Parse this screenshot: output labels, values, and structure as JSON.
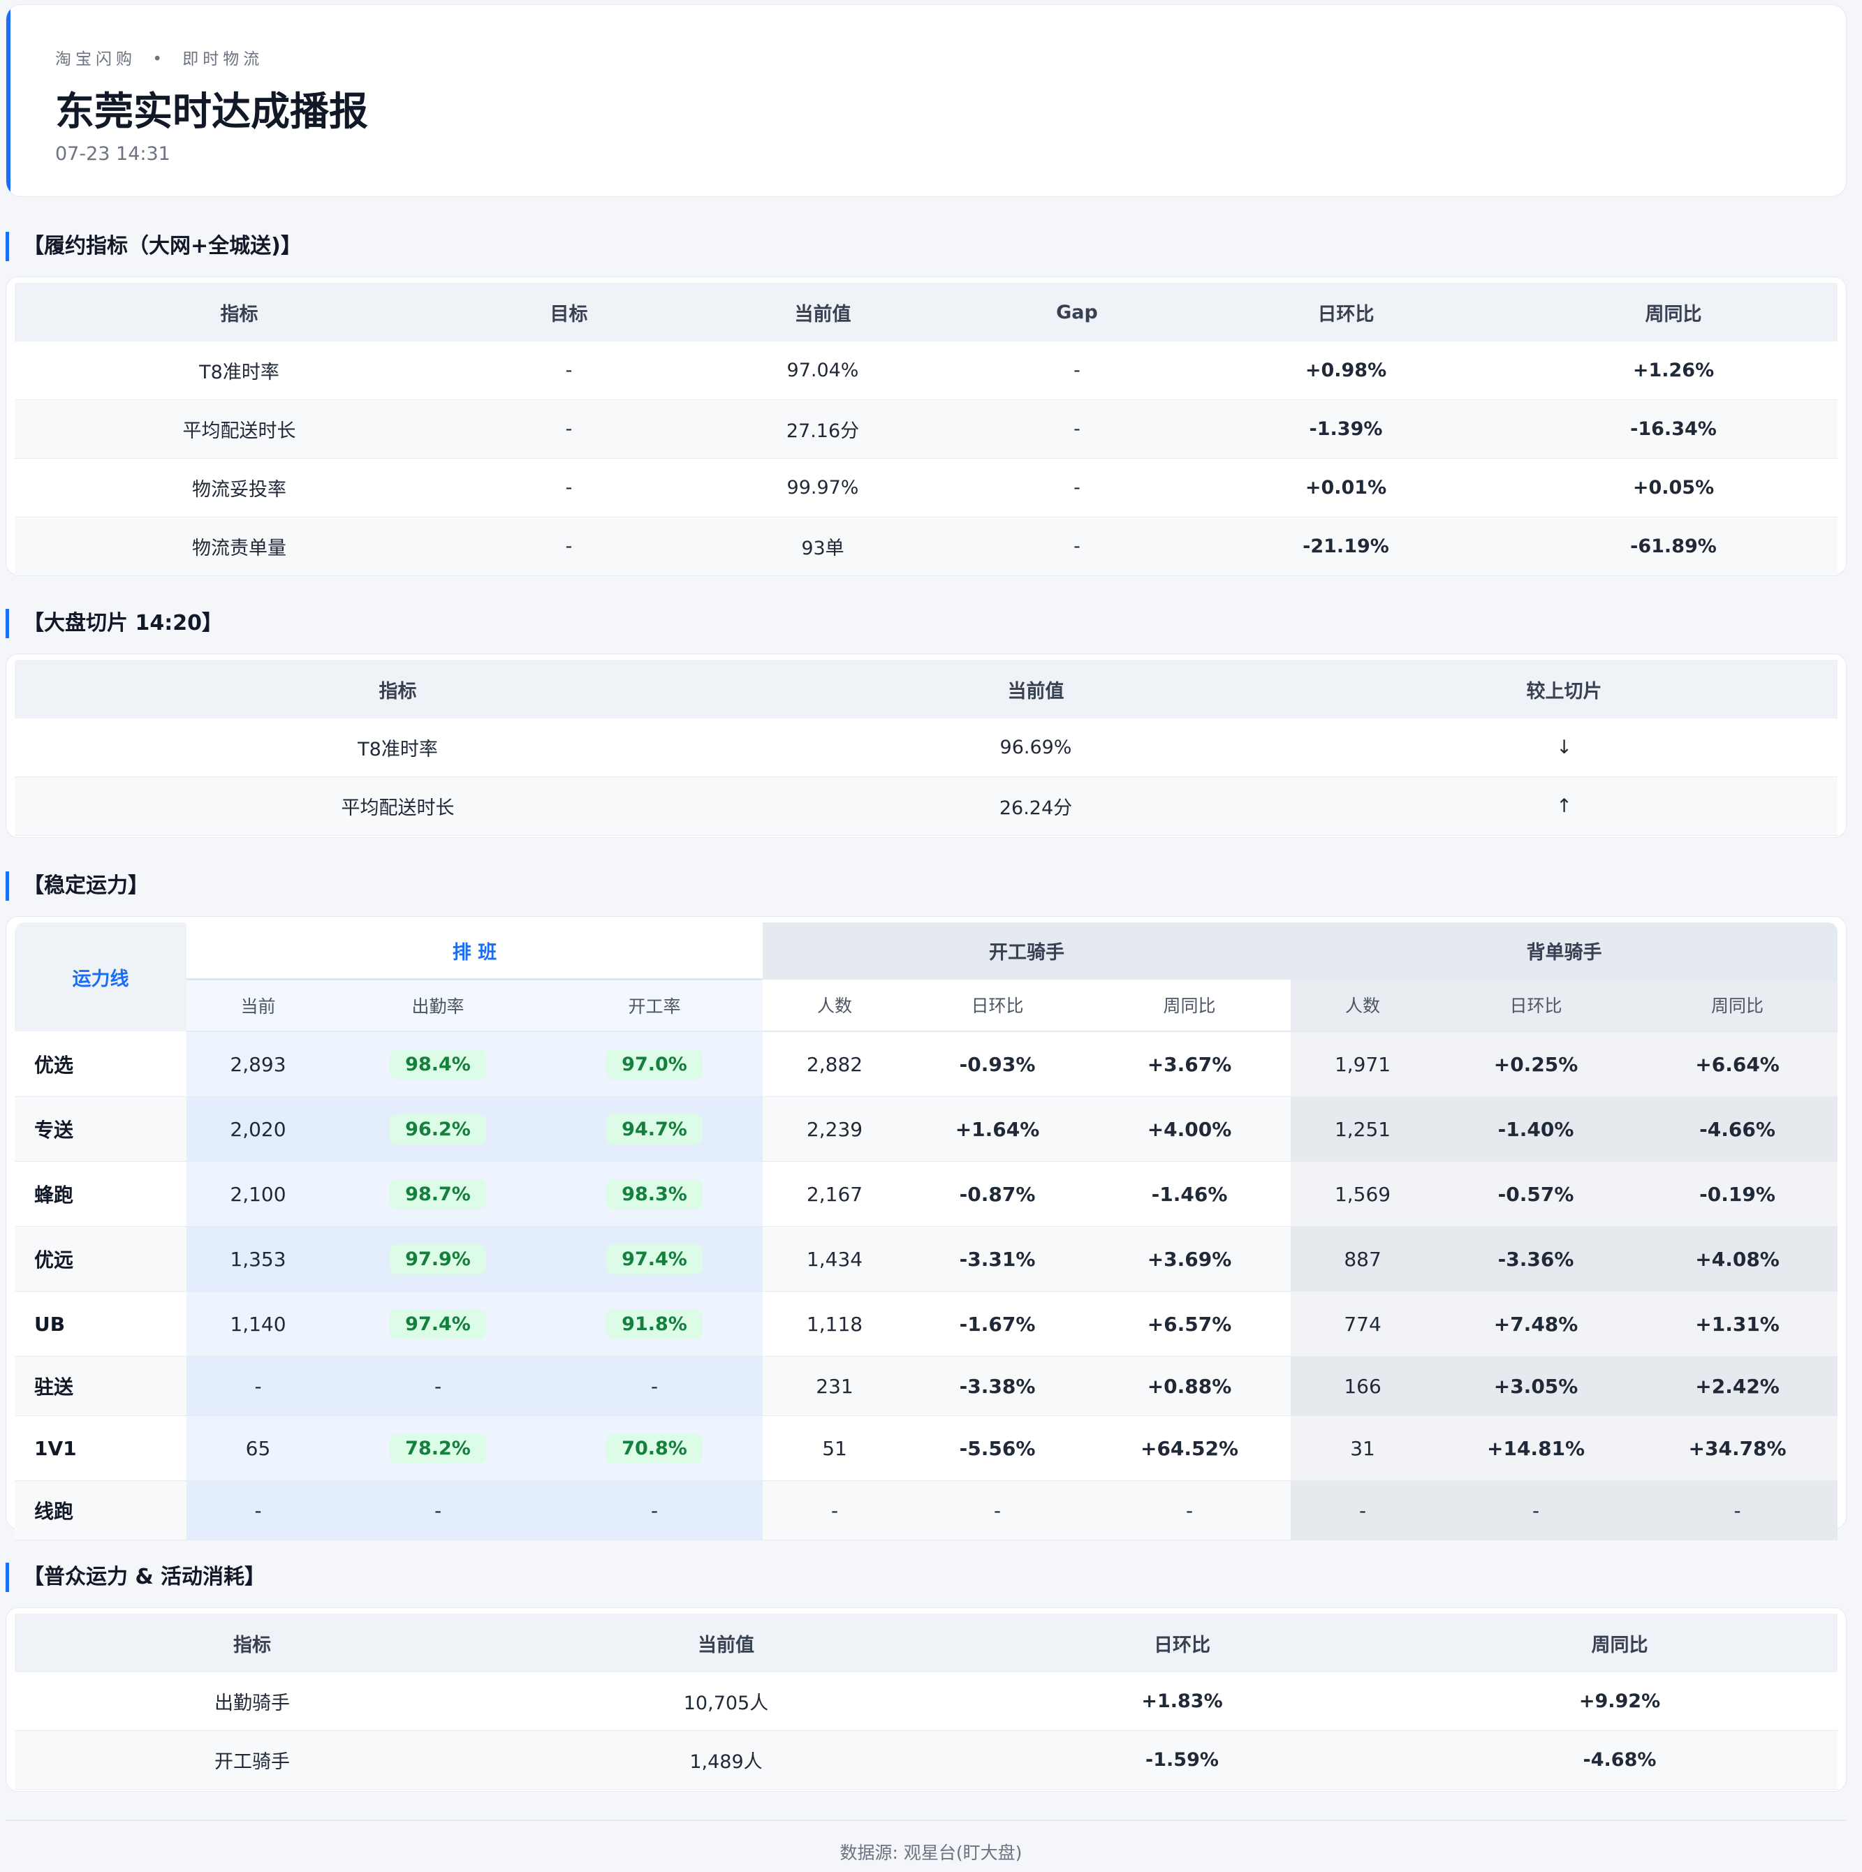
{
  "header": {
    "sub_left": "淘宝闪购",
    "sub_dot": "•",
    "sub_right": "即时物流",
    "title": "东莞实时达成播报",
    "time": "07-23 14:31"
  },
  "fulfillment": {
    "title": "【履约指标（大网+全城送)】",
    "headers": [
      "指标",
      "目标",
      "当前值",
      "Gap",
      "日环比",
      "周同比"
    ],
    "rows": [
      {
        "name": "T8准时率",
        "target": "-",
        "value": "97.04%",
        "gap": "-",
        "dod": "+0.98%",
        "wow": "+1.26%",
        "dod_c": "g",
        "wow_c": "g"
      },
      {
        "name": "平均配送时长",
        "target": "-",
        "value": "27.16分",
        "gap": "-",
        "dod": "-1.39%",
        "wow": "-16.34%",
        "dod_c": "g",
        "wow_c": "g"
      },
      {
        "name": "物流妥投率",
        "target": "-",
        "value": "99.97%",
        "gap": "-",
        "dod": "+0.01%",
        "wow": "+0.05%",
        "dod_c": "g",
        "wow_c": "g"
      },
      {
        "name": "物流责单量",
        "target": "-",
        "value": "93单",
        "gap": "-",
        "dod": "-21.19%",
        "wow": "-61.89%",
        "dod_c": "g",
        "wow_c": "g"
      }
    ]
  },
  "slice": {
    "title": "【大盘切片 14:20】",
    "headers": [
      "指标",
      "当前值",
      "较上切片"
    ],
    "rows": [
      {
        "name": "T8准时率",
        "value": "96.69%",
        "trend": "↓"
      },
      {
        "name": "平均配送时长",
        "value": "26.24分",
        "trend": "↑"
      }
    ]
  },
  "capacity": {
    "title": "【稳定运力】",
    "line_header": "运力线",
    "group_schedule": "排 班",
    "group_start": "开工骑手",
    "group_back": "背单骑手",
    "sub_headers": [
      "当前",
      "出勤率",
      "开工率",
      "人数",
      "日环比",
      "周同比",
      "人数",
      "日环比",
      "周同比"
    ],
    "rows": [
      {
        "name": "优选",
        "cur": "2,893",
        "att": "98.4%",
        "work": "97.0%",
        "s_n": "2,882",
        "s_d": "-0.93%",
        "s_w": "+3.67%",
        "b_n": "1,971",
        "b_d": "+0.25%",
        "b_w": "+6.64%",
        "c": [
          "r",
          "g",
          "g",
          "g"
        ]
      },
      {
        "name": "专送",
        "cur": "2,020",
        "att": "96.2%",
        "work": "94.7%",
        "s_n": "2,239",
        "s_d": "+1.64%",
        "s_w": "+4.00%",
        "b_n": "1,251",
        "b_d": "-1.40%",
        "b_w": "-4.66%",
        "c": [
          "g",
          "g",
          "r",
          "r"
        ]
      },
      {
        "name": "蜂跑",
        "cur": "2,100",
        "att": "98.7%",
        "work": "98.3%",
        "s_n": "2,167",
        "s_d": "-0.87%",
        "s_w": "-1.46%",
        "b_n": "1,569",
        "b_d": "-0.57%",
        "b_w": "-0.19%",
        "c": [
          "r",
          "r",
          "r",
          "r"
        ]
      },
      {
        "name": "优远",
        "cur": "1,353",
        "att": "97.9%",
        "work": "97.4%",
        "s_n": "1,434",
        "s_d": "-3.31%",
        "s_w": "+3.69%",
        "b_n": "887",
        "b_d": "-3.36%",
        "b_w": "+4.08%",
        "c": [
          "r",
          "g",
          "r",
          "g"
        ]
      },
      {
        "name": "UB",
        "cur": "1,140",
        "att": "97.4%",
        "work": "91.8%",
        "s_n": "1,118",
        "s_d": "-1.67%",
        "s_w": "+6.57%",
        "b_n": "774",
        "b_d": "+7.48%",
        "b_w": "+1.31%",
        "c": [
          "r",
          "g",
          "g",
          "g"
        ]
      },
      {
        "name": "驻送",
        "cur": "-",
        "att": "-",
        "work": "-",
        "s_n": "231",
        "s_d": "-3.38%",
        "s_w": "+0.88%",
        "b_n": "166",
        "b_d": "+3.05%",
        "b_w": "+2.42%",
        "c": [
          "r",
          "g",
          "g",
          "g"
        ]
      },
      {
        "name": "1V1",
        "cur": "65",
        "att": "78.2%",
        "work": "70.8%",
        "s_n": "51",
        "s_d": "-5.56%",
        "s_w": "+64.52%",
        "b_n": "31",
        "b_d": "+14.81%",
        "b_w": "+34.78%",
        "c": [
          "r",
          "g",
          "g",
          "g"
        ]
      },
      {
        "name": "线跑",
        "cur": "-",
        "att": "-",
        "work": "-",
        "s_n": "-",
        "s_d": "-",
        "s_w": "-",
        "b_n": "-",
        "b_d": "-",
        "b_w": "-",
        "c": [
          "",
          "",
          "",
          ""
        ]
      }
    ]
  },
  "public": {
    "title": "【普众运力 & 活动消耗】",
    "headers": [
      "指标",
      "当前值",
      "日环比",
      "周同比"
    ],
    "rows": [
      {
        "name": "出勤骑手",
        "value": "10,705人",
        "dod": "+1.83%",
        "wow": "+9.92%",
        "dod_c": "g",
        "wow_c": "g"
      },
      {
        "name": "开工骑手",
        "value": "1,489人",
        "dod": "-1.59%",
        "wow": "-4.68%",
        "dod_c": "r",
        "wow_c": "r"
      }
    ]
  },
  "footer": {
    "source": "数据源: 观星台(盯大盘)"
  },
  "colors": {
    "accent": "#1a6ef5",
    "positive": "#15803d",
    "negative": "#c81e1e",
    "pill_bg": "#dcfce7"
  }
}
